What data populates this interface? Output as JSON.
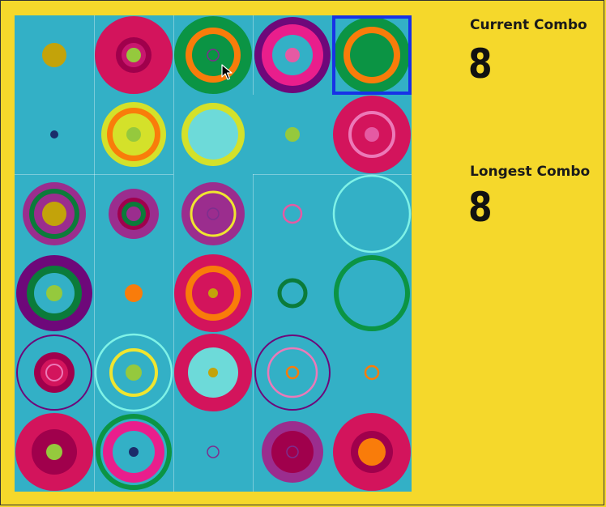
{
  "current_combo": {
    "label": "Current Combo",
    "value": "8"
  },
  "longest_combo": {
    "label": "Longest Combo",
    "value": "8"
  },
  "colors": {
    "background": "#f5d82b",
    "board": "#33b0c6",
    "selection": "#1732e6"
  },
  "selected_cell": {
    "row": 0,
    "col": 4
  },
  "cursor_icon": "mouse-pointer-icon",
  "grid": [
    [
      [
        [
          "disc",
          15,
          "#c3a30a"
        ]
      ],
      [
        [
          "disc",
          48,
          "#d3145c"
        ],
        [
          "disc",
          22,
          "#a0004c"
        ],
        [
          "disc",
          15,
          "#c9176f"
        ],
        [
          "disc",
          9,
          "#95c93d"
        ]
      ],
      [
        [
          "disc",
          48,
          "#0b9444"
        ],
        [
          "disc",
          34,
          "#f97c0a"
        ],
        [
          "disc",
          26,
          "#0b9444"
        ],
        [
          "ring",
          7,
          "#7d2e8e",
          1.5
        ]
      ],
      [
        [
          "disc",
          47,
          "#6e087a"
        ],
        [
          "disc",
          38,
          "#e91e8c"
        ],
        [
          "disc",
          25,
          "#33b0c6"
        ],
        [
          "disc",
          9,
          "#e55aa3"
        ]
      ],
      [
        [
          "disc",
          47,
          "#0b9444"
        ],
        [
          "disc",
          35,
          "#f97c0a"
        ],
        [
          "disc",
          27,
          "#0b9444"
        ]
      ]
    ],
    [
      [
        [
          "disc",
          5,
          "#1b2c6a"
        ]
      ],
      [
        [
          "disc",
          40,
          "#d4e12a"
        ],
        [
          "disc",
          33,
          "#f97c0a"
        ],
        [
          "disc",
          26,
          "#d4e12a"
        ],
        [
          "disc",
          9,
          "#95c93d"
        ]
      ],
      [
        [
          "disc",
          39,
          "#d4e12a"
        ],
        [
          "disc",
          31,
          "#6ddad9"
        ]
      ],
      [
        [
          "disc",
          9,
          "#95c93d"
        ]
      ],
      [
        [
          "disc",
          48,
          "#d3145c"
        ],
        [
          "ring",
          27,
          "#ec79b8",
          4
        ],
        [
          "disc",
          9,
          "#e55aa3"
        ]
      ]
    ],
    [
      [
        [
          "disc",
          39,
          "#9b2d8e"
        ],
        [
          "disc",
          31,
          "#0b7b3a"
        ],
        [
          "disc",
          25,
          "#9b2d8e"
        ],
        [
          "disc",
          15,
          "#c3a30a"
        ]
      ],
      [
        [
          "disc",
          31,
          "#9b2d8e"
        ],
        [
          "disc",
          20,
          "#a0004c"
        ],
        [
          "disc",
          15,
          "#0b7b3a"
        ],
        [
          "disc",
          9,
          "#9b2d8e"
        ]
      ],
      [
        [
          "disc",
          39,
          "#9b2d8e"
        ],
        [
          "ring",
          27,
          "#f0e52f",
          3
        ],
        [
          "ring",
          7,
          "#7d2e8e",
          1.5
        ]
      ],
      [
        [
          "ring",
          11,
          "#e55aa3",
          2.5
        ]
      ],
      [
        [
          "ring",
          47,
          "#7ff2e7",
          2.5
        ]
      ]
    ],
    [
      [
        [
          "disc",
          47,
          "#6e087a"
        ],
        [
          "disc",
          34,
          "#0b7b3a"
        ],
        [
          "disc",
          25,
          "#33b0c6"
        ],
        [
          "disc",
          10,
          "#95c93d"
        ]
      ],
      [
        [
          "disc",
          11,
          "#f97c0a"
        ]
      ],
      [
        [
          "disc",
          48,
          "#d3145c"
        ],
        [
          "disc",
          34,
          "#f97c0a"
        ],
        [
          "disc",
          26,
          "#d3145c"
        ],
        [
          "disc",
          6,
          "#c3a30a"
        ]
      ],
      [
        [
          "ring",
          16,
          "#0b7b3a",
          5
        ]
      ],
      [
        [
          "ring",
          44,
          "#0b9444",
          6
        ]
      ]
    ],
    [
      [
        [
          "ring",
          46,
          "#6e087a",
          2
        ],
        [
          "disc",
          25,
          "#a0004c"
        ],
        [
          "disc",
          17,
          "#d3145c"
        ],
        [
          "ring",
          10,
          "#ec79b8",
          2
        ]
      ],
      [
        [
          "ring",
          47,
          "#7ff2e7",
          2.5
        ],
        [
          "ring",
          28,
          "#f0e52f",
          4
        ],
        [
          "disc",
          10,
          "#95c93d"
        ]
      ],
      [
        [
          "disc",
          48,
          "#d3145c"
        ],
        [
          "disc",
          31,
          "#6ddad9"
        ],
        [
          "disc",
          6,
          "#c3a30a"
        ]
      ],
      [
        [
          "ring",
          46,
          "#6e087a",
          2
        ],
        [
          "ring",
          30,
          "#ec79b8",
          2.5
        ],
        [
          "ring",
          7,
          "#f97c0a",
          2.5
        ]
      ],
      [
        [
          "ring",
          8,
          "#f97c0a",
          2.5
        ]
      ]
    ],
    [
      [
        [
          "disc",
          48,
          "#d3145c"
        ],
        [
          "disc",
          28,
          "#a0004c"
        ],
        [
          "disc",
          10,
          "#95c93d"
        ]
      ],
      [
        [
          "ring",
          44,
          "#0b9444",
          6
        ],
        [
          "disc",
          38,
          "#e91e8c"
        ],
        [
          "disc",
          26,
          "#33b0c6"
        ],
        [
          "disc",
          6,
          "#1b2c6a"
        ]
      ],
      [
        [
          "ring",
          7,
          "#7d2e8e",
          1.5
        ]
      ],
      [
        [
          "disc",
          38,
          "#9b2d8e"
        ],
        [
          "disc",
          26,
          "#a0004c"
        ],
        [
          "ring",
          7,
          "#7d2e8e",
          1.5
        ]
      ],
      [
        [
          "disc",
          48,
          "#d3145c"
        ],
        [
          "disc",
          26,
          "#a0004c"
        ],
        [
          "disc",
          17,
          "#f97c0a"
        ],
        [
          "disc",
          9,
          "#f97c0a"
        ]
      ]
    ]
  ]
}
